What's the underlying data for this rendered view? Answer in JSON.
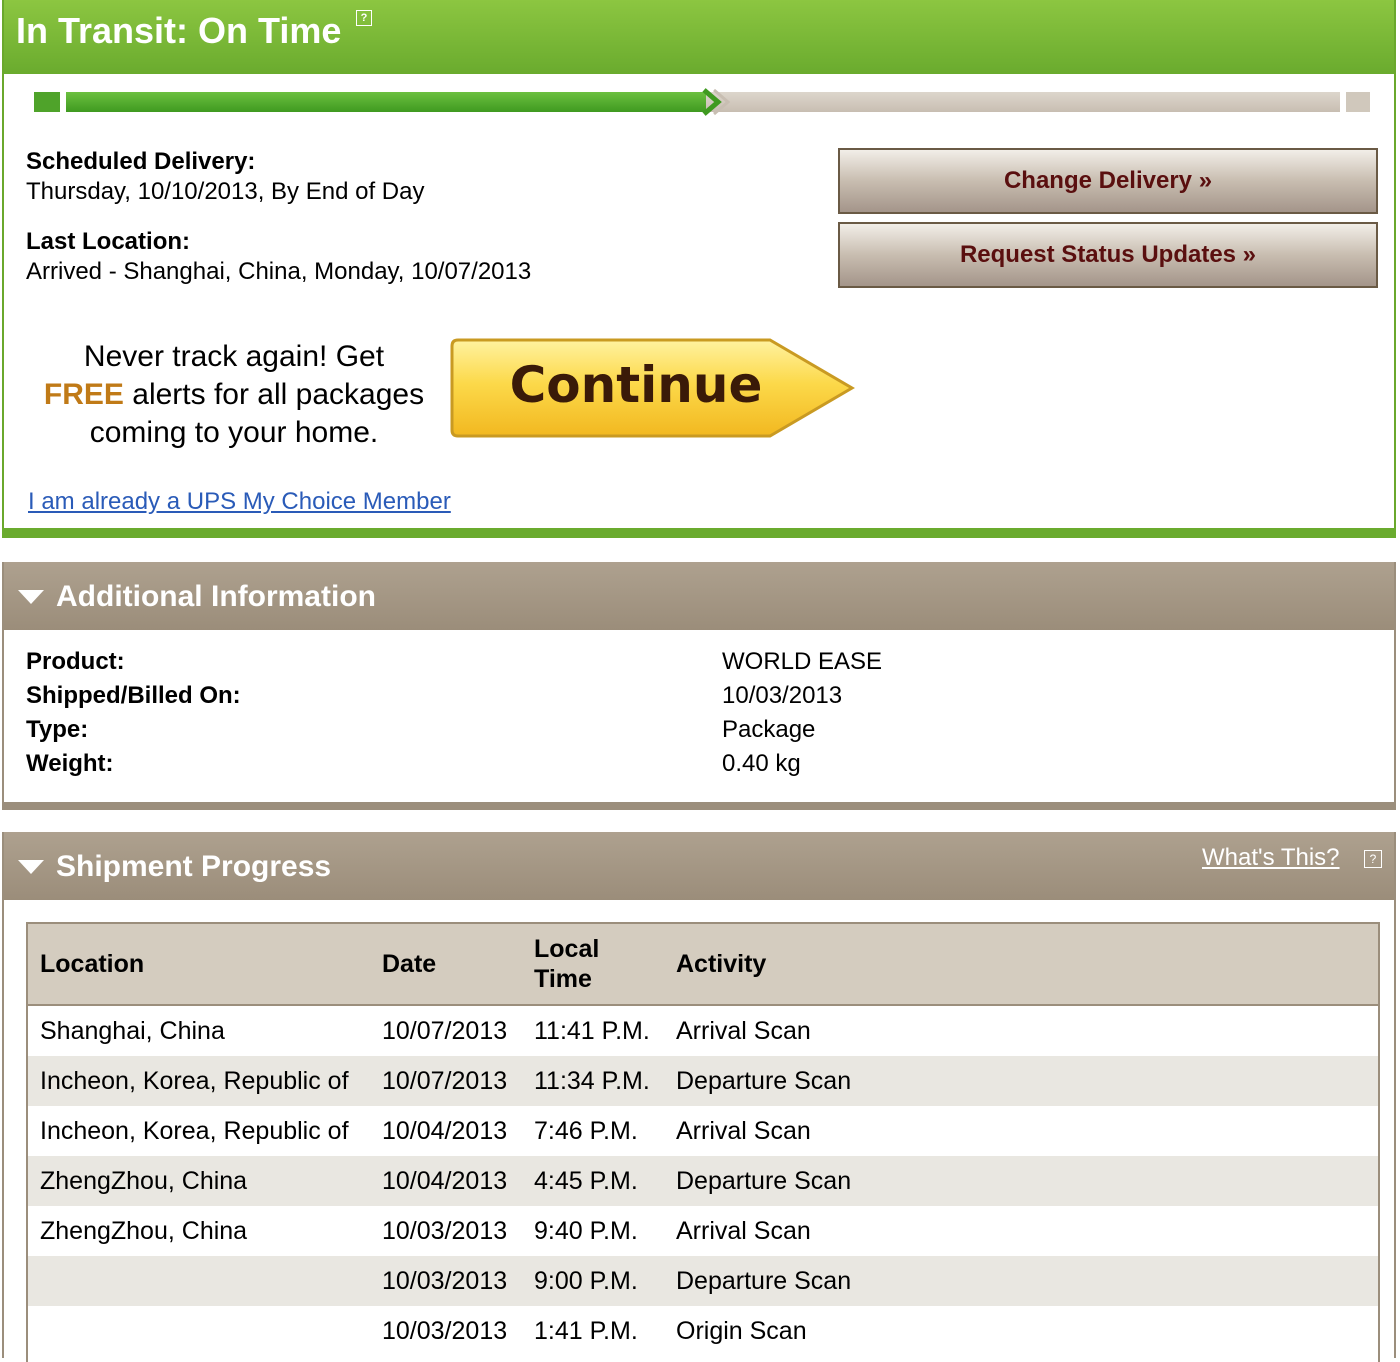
{
  "status": {
    "title": "In Transit: On Time",
    "help_glyph": "?",
    "progress_fraction": 0.5,
    "scheduled_label": "Scheduled Delivery:",
    "scheduled_value": "Thursday, 10/10/2013, By End of Day",
    "last_location_label": "Last Location:",
    "last_location_value": "Arrived - Shanghai, China, Monday, 10/07/2013",
    "change_delivery": "Change Delivery »",
    "request_updates": "Request Status Updates »",
    "promo_line1": "Never track again! Get",
    "promo_free": "FREE",
    "promo_line2_rest": " alerts for all packages",
    "promo_line3": "coming to your home.",
    "continue_label": "Continue",
    "member_link": "I am already a UPS My Choice Member",
    "colors": {
      "header_green": "#7ab835",
      "link_blue": "#2a5bb8",
      "free_orange": "#c07a17",
      "continue_yellow": "#f7d13a"
    }
  },
  "additional": {
    "title": "Additional Information",
    "rows": [
      {
        "label": "Product:",
        "value": "WORLD EASE"
      },
      {
        "label": "Shipped/Billed On:",
        "value": "10/03/2013"
      },
      {
        "label": "Type:",
        "value": "Package"
      },
      {
        "label": "Weight:",
        "value": "0.40 kg"
      }
    ]
  },
  "progress": {
    "title": "Shipment Progress",
    "whats_this": "What's This?",
    "help_glyph": "?",
    "columns": {
      "location": "Location",
      "date": "Date",
      "time_line1": "Local",
      "time_line2": "Time",
      "activity": "Activity"
    },
    "rows": [
      {
        "location": "Shanghai, China",
        "date": "10/07/2013",
        "time": "11:41 P.M.",
        "activity": "Arrival Scan"
      },
      {
        "location": "Incheon, Korea, Republic of",
        "date": "10/07/2013",
        "time": "11:34 P.M.",
        "activity": "Departure Scan"
      },
      {
        "location": "Incheon, Korea, Republic of",
        "date": "10/04/2013",
        "time": "7:46 P.M.",
        "activity": "Arrival Scan"
      },
      {
        "location": "ZhengZhou, China",
        "date": "10/04/2013",
        "time": "4:45 P.M.",
        "activity": "Departure Scan"
      },
      {
        "location": "ZhengZhou, China",
        "date": "10/03/2013",
        "time": "9:40 P.M.",
        "activity": "Arrival Scan"
      },
      {
        "location": "",
        "date": "10/03/2013",
        "time": "9:00 P.M.",
        "activity": "Departure Scan"
      },
      {
        "location": "",
        "date": "10/03/2013",
        "time": "1:41 P.M.",
        "activity": "Origin Scan"
      }
    ]
  }
}
